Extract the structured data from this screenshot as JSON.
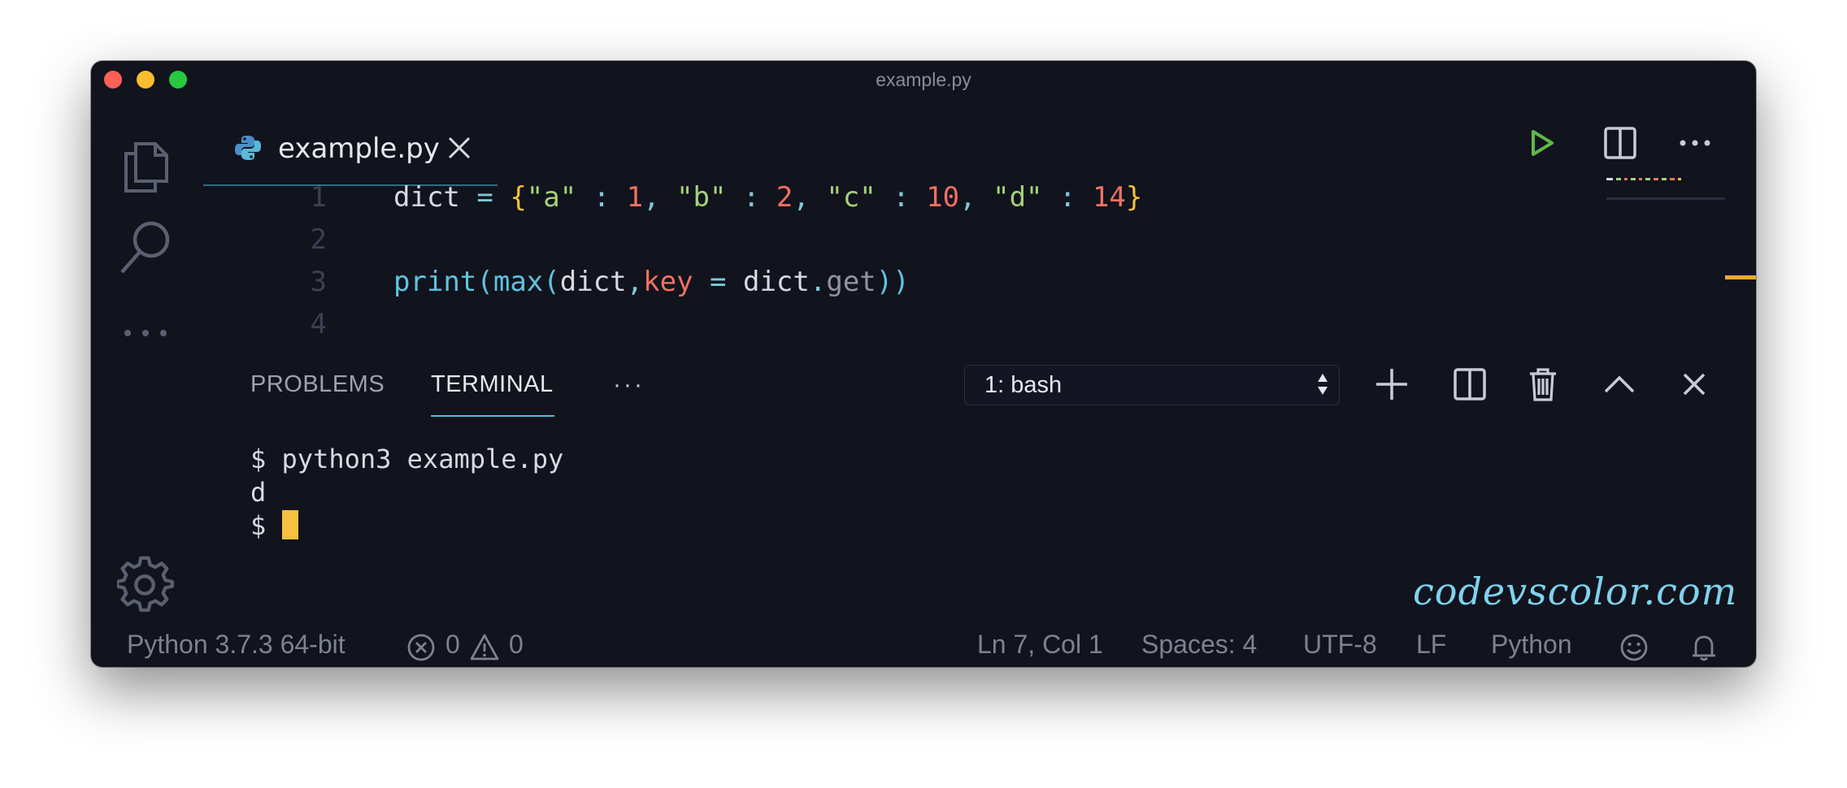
{
  "window": {
    "title": "example.py"
  },
  "activity_bar": {
    "items": [
      {
        "icon": "files-icon"
      },
      {
        "icon": "search-icon"
      },
      {
        "icon": "more-icon",
        "label": "···"
      },
      {
        "icon": "gear-icon"
      }
    ]
  },
  "editor": {
    "tab": {
      "label": "example.py",
      "icon": "python-icon"
    },
    "actions": [
      "run-icon",
      "split-editor-icon",
      "more-actions-icon"
    ],
    "lines": [
      {
        "number": "1",
        "tokens": [
          {
            "t": "dict",
            "c": "c-id"
          },
          {
            "t": " = ",
            "c": "c-op"
          },
          {
            "t": "{",
            "c": "c-brace"
          },
          {
            "t": "\"a\"",
            "c": "c-str"
          },
          {
            "t": " : ",
            "c": "c-op"
          },
          {
            "t": "1",
            "c": "c-num"
          },
          {
            "t": ", ",
            "c": "c-op"
          },
          {
            "t": "\"b\"",
            "c": "c-str"
          },
          {
            "t": " : ",
            "c": "c-op"
          },
          {
            "t": "2",
            "c": "c-num"
          },
          {
            "t": ", ",
            "c": "c-op"
          },
          {
            "t": "\"c\"",
            "c": "c-str"
          },
          {
            "t": " : ",
            "c": "c-op"
          },
          {
            "t": "10",
            "c": "c-num"
          },
          {
            "t": ", ",
            "c": "c-op"
          },
          {
            "t": "\"d\"",
            "c": "c-str"
          },
          {
            "t": " : ",
            "c": "c-op"
          },
          {
            "t": "14",
            "c": "c-num"
          },
          {
            "t": "}",
            "c": "c-brace"
          }
        ]
      },
      {
        "number": "2",
        "tokens": []
      },
      {
        "number": "3",
        "tokens": [
          {
            "t": "print",
            "c": "c-fn"
          },
          {
            "t": "(",
            "c": "c-fn"
          },
          {
            "t": "max",
            "c": "c-fn"
          },
          {
            "t": "(",
            "c": "c-fn"
          },
          {
            "t": "dict",
            "c": "c-id"
          },
          {
            "t": ",",
            "c": "c-op"
          },
          {
            "t": "key",
            "c": "c-kw"
          },
          {
            "t": " = ",
            "c": "c-op"
          },
          {
            "t": "dict",
            "c": "c-id"
          },
          {
            "t": ".",
            "c": "c-op"
          },
          {
            "t": "get",
            "c": "c-muted"
          },
          {
            "t": "))",
            "c": "c-fn"
          }
        ]
      },
      {
        "number": "4",
        "tokens": []
      }
    ]
  },
  "panel": {
    "tabs": [
      {
        "label": "PROBLEMS"
      },
      {
        "label": "TERMINAL"
      }
    ],
    "more_label": "···",
    "terminal_select": "1: bash",
    "actions": [
      "plus-icon",
      "split-terminal-icon",
      "trash-icon",
      "chevron-up-icon",
      "close-icon"
    ],
    "terminal_lines": [
      "$ python3 example.py",
      "d",
      "$ "
    ]
  },
  "watermark": "codevscolor.com",
  "status_bar": {
    "interpreter": "Python 3.7.3 64-bit",
    "errors": "0",
    "warnings": "0",
    "position": "Ln 7, Col 1",
    "spaces": "Spaces: 4",
    "encoding": "UTF-8",
    "eol": "LF",
    "language": "Python"
  },
  "colors": {
    "background": "#11131d",
    "accent": "#4bbfd9",
    "cursor": "#f5c13e",
    "run": "#5fb84a"
  }
}
